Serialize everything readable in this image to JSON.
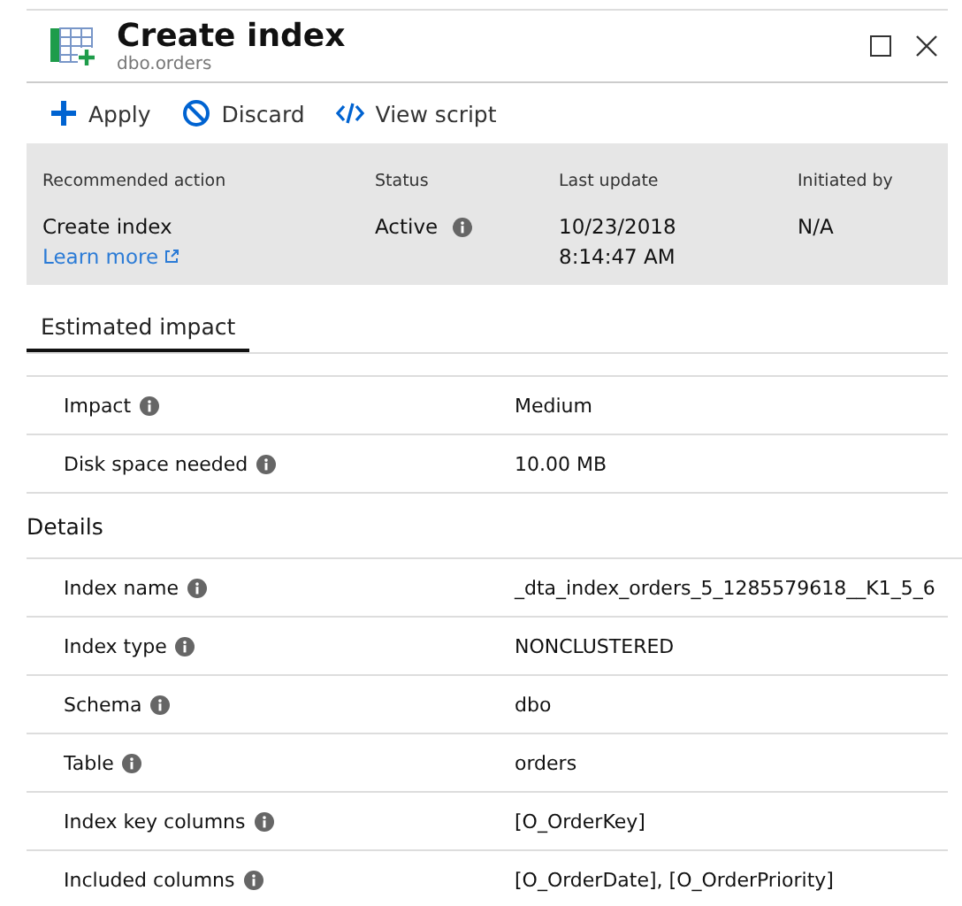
{
  "header": {
    "title": "Create index",
    "subtitle": "dbo.orders"
  },
  "toolbar": [
    {
      "kind": "plus",
      "label": "Apply"
    },
    {
      "kind": "block",
      "label": "Discard"
    },
    {
      "kind": "code",
      "label": "View script"
    }
  ],
  "summary": {
    "columns": [
      {
        "heading": "Recommended action",
        "value": "Create index",
        "link": "Learn more",
        "info": false
      },
      {
        "heading": "Status",
        "value": "Active",
        "info": true
      },
      {
        "heading": "Last update",
        "value": "10/23/2018",
        "value2": "8:14:47 AM",
        "info": false
      },
      {
        "heading": "Initiated by",
        "value": "N/A",
        "info": false
      }
    ]
  },
  "tabs": [
    {
      "label": "Estimated impact",
      "selected": true
    }
  ],
  "impact": [
    {
      "label": "Impact",
      "value": "Medium"
    },
    {
      "label": "Disk space needed",
      "value": "10.00 MB"
    }
  ],
  "details": {
    "heading": "Details",
    "rows": [
      {
        "label": "Index name",
        "value": "_dta_index_orders_5_1285579618__K1_5_6"
      },
      {
        "label": "Index type",
        "value": "NONCLUSTERED"
      },
      {
        "label": "Schema",
        "value": "dbo"
      },
      {
        "label": "Table",
        "value": "orders"
      },
      {
        "label": "Index key columns",
        "value": "[O_OrderKey]"
      },
      {
        "label": "Included columns",
        "value": "[O_OrderDate], [O_OrderPriority]"
      }
    ]
  }
}
